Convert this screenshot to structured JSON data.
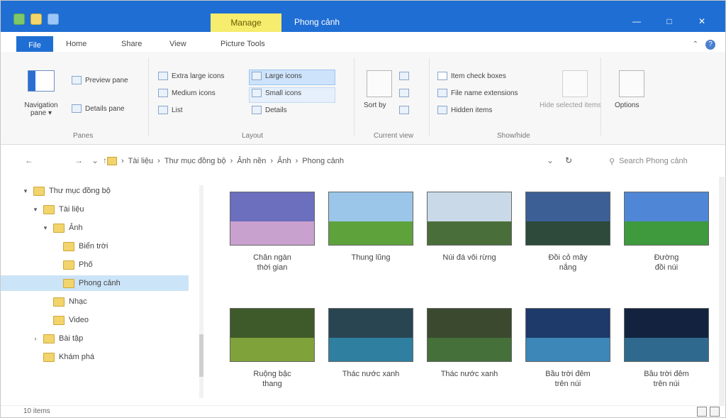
{
  "titlebar": {
    "contextual_tab": "Manage",
    "title": "Phong cảnh",
    "minimize": "—",
    "maximize": "□",
    "close": "✕"
  },
  "ribbon_tabs": {
    "file": "File",
    "home": "Home",
    "share": "Share",
    "view": "View",
    "picture_tools": "Picture Tools"
  },
  "ribbon": {
    "navigation_pane": "Navigation pane ▾",
    "preview_pane": "Preview pane",
    "details_pane": "Details pane",
    "extra_large_icons": "Extra large icons",
    "medium_icons": "Medium icons",
    "list": "List",
    "large_icons": "Large icons",
    "small_icons": "Small icons",
    "details": "Details",
    "sort_by": "Sort by",
    "item_check_boxes": "Item check boxes",
    "file_name_extensions": "File name extensions",
    "hidden_items": "Hidden items",
    "hide_selected": "Hide selected items",
    "options": "Options",
    "groups": {
      "panes": "Panes",
      "layout": "Layout",
      "current_view": "Current view",
      "show_hide": "Show/hide"
    }
  },
  "address": {
    "crumbs": [
      "Tài liệu",
      "Thư mục đồng bộ",
      "Ảnh nền",
      "Ảnh",
      "Phong cảnh"
    ],
    "search_placeholder": "Search Phong cảnh"
  },
  "tree": [
    {
      "label": "Thư mục đồng bộ",
      "indent": 0,
      "chev": "▾",
      "selected": false
    },
    {
      "label": "Tài liệu",
      "indent": 1,
      "chev": "▾",
      "selected": false
    },
    {
      "label": "Ảnh",
      "indent": 2,
      "chev": "▾",
      "selected": false
    },
    {
      "label": "Biển trời",
      "indent": 3,
      "chev": "",
      "selected": false
    },
    {
      "label": "Phố",
      "indent": 3,
      "chev": "",
      "selected": false
    },
    {
      "label": "Phong cảnh",
      "indent": 3,
      "chev": "",
      "selected": true
    },
    {
      "label": "Nhạc",
      "indent": 2,
      "chev": "",
      "selected": false
    },
    {
      "label": "Video",
      "indent": 2,
      "chev": "",
      "selected": false
    },
    {
      "label": "Bài tập",
      "indent": 1,
      "chev": "›",
      "selected": false
    },
    {
      "label": "Khám phá",
      "indent": 1,
      "chev": "",
      "selected": false
    }
  ],
  "tiles": [
    {
      "caption": "Chân ngàn\nthời gian",
      "sky": "#6b6fbe",
      "ground": "#c9a1cf"
    },
    {
      "caption": "Thung lũng",
      "sky": "#9bc6ea",
      "ground": "#5ea23c"
    },
    {
      "caption": "Núi đá vôi rừng",
      "sky": "#c9d9e8",
      "ground": "#4a6e3a"
    },
    {
      "caption": "Đồi cỏ mây\nnắng",
      "sky": "#3c5f95",
      "ground": "#2d4a3a"
    },
    {
      "caption": "Đường\nđồi núi",
      "sky": "#4f87d6",
      "ground": "#3e9a3c"
    },
    {
      "caption": "Ruộng bậc\nthang",
      "sky": "#3e5a2a",
      "ground": "#7fa33a"
    },
    {
      "caption": "Thác nước xanh",
      "sky": "#2a4552",
      "ground": "#2f7fa0"
    },
    {
      "caption": "Thác nước xanh",
      "sky": "#3b4a2f",
      "ground": "#46703a"
    },
    {
      "caption": "Bầu trời đêm\ntrên núi",
      "sky": "#1d3a6a",
      "ground": "#3d86b8"
    },
    {
      "caption": "Bầu trời đêm\ntrên núi",
      "sky": "#13233f",
      "ground": "#2f6a8e"
    }
  ],
  "status": {
    "items": "10 items"
  }
}
